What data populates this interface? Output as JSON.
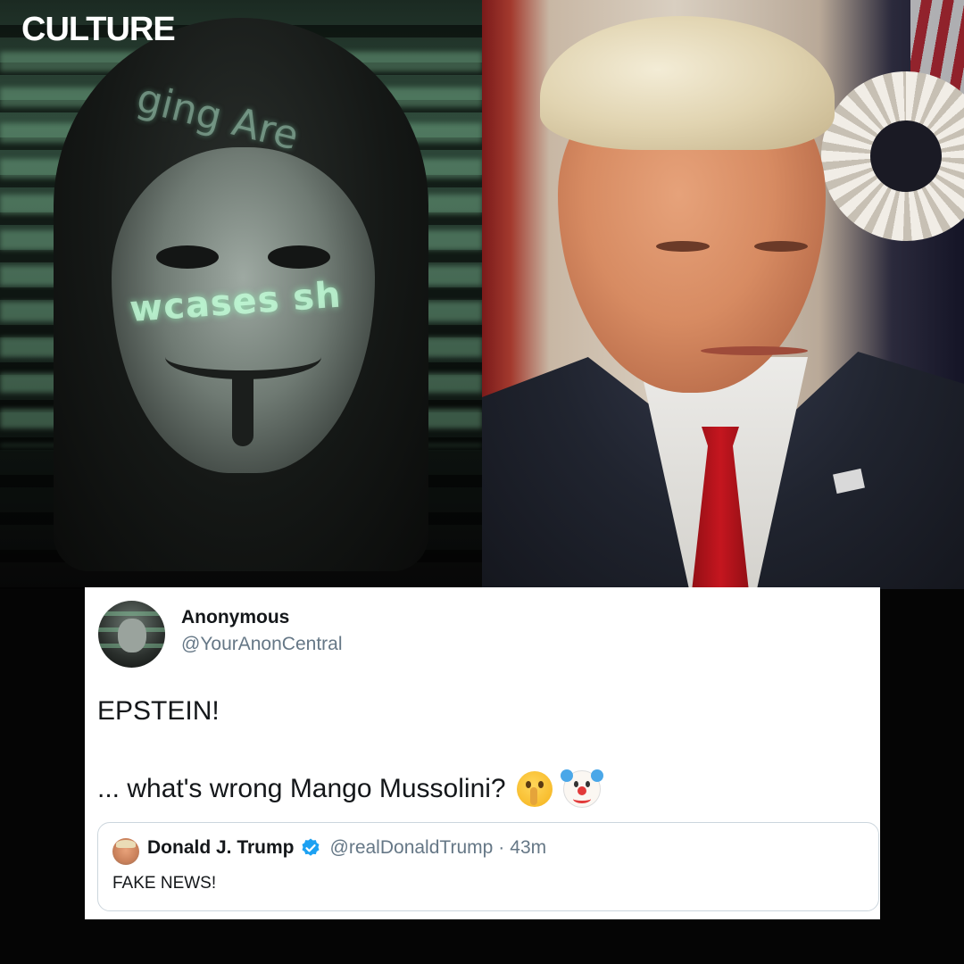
{
  "brand": {
    "logo_text": "CULTURE"
  },
  "images": {
    "left": {
      "overlay_text_mask": "wcases sh",
      "overlay_text_hood": "ging Are"
    }
  },
  "tweet": {
    "author_name": "Anonymous",
    "author_handle": "@YourAnonCentral",
    "line1": "EPSTEIN!",
    "line2": "... what's wrong Mango Mussolini?",
    "emojis": [
      "shushing-face-icon",
      "clown-face-icon"
    ],
    "quoted": {
      "author_name": "Donald J. Trump",
      "verified": true,
      "author_handle": "@realDonaldTrump",
      "separator": "·",
      "time": "43m",
      "text": "FAKE NEWS!"
    }
  },
  "colors": {
    "background": "#050505",
    "card": "#ffffff",
    "text_primary": "#14171a",
    "text_secondary": "#657786",
    "verified_blue": "#1da1f2",
    "quote_border": "#ccd6dd"
  }
}
